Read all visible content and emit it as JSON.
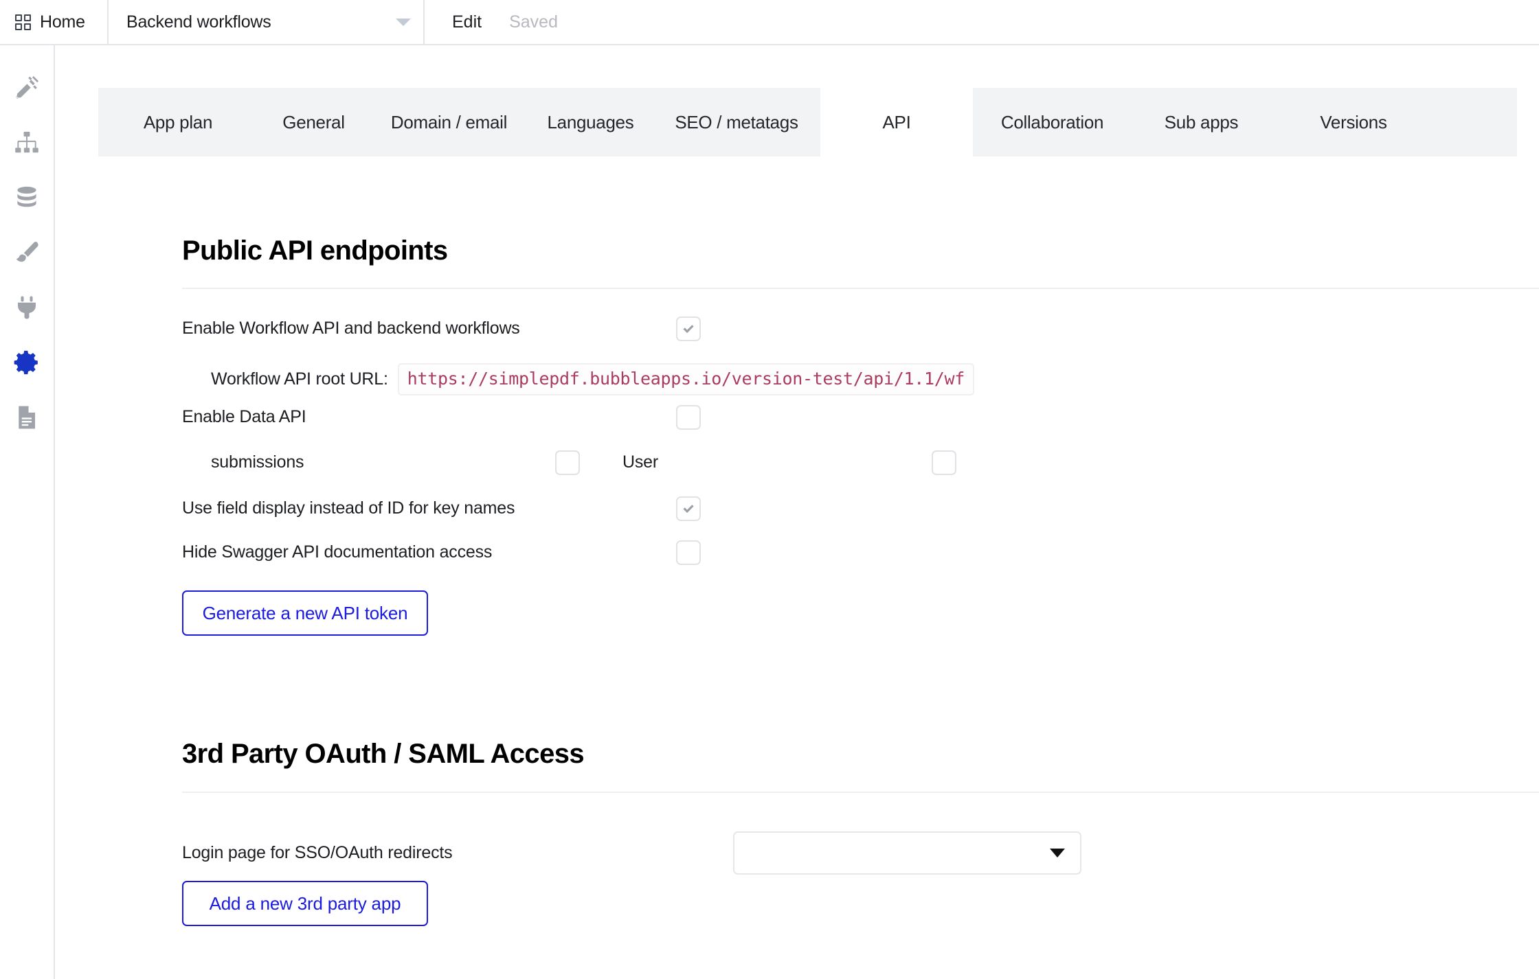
{
  "topbar": {
    "home_label": "Home",
    "home_icon": "grid-squares-icon",
    "app_selector_value": "Backend workflows",
    "app_selector_caret": "chevron-down-icon",
    "edit_label": "Edit",
    "status_label": "Saved"
  },
  "sidebar": {
    "items": [
      {
        "name": "design",
        "icon": "pencil-ruler-icon",
        "active": false
      },
      {
        "name": "workflow",
        "icon": "hierarchy-icon",
        "active": false
      },
      {
        "name": "data",
        "icon": "database-icon",
        "active": false
      },
      {
        "name": "styles",
        "icon": "paintbrush-icon",
        "active": false
      },
      {
        "name": "plugins",
        "icon": "plug-icon",
        "active": false
      },
      {
        "name": "settings",
        "icon": "gear-icon",
        "active": true
      },
      {
        "name": "logs",
        "icon": "document-icon",
        "active": false
      }
    ],
    "active_color": "#1834c4",
    "inactive_color": "#a0a4aa"
  },
  "tabs": [
    {
      "label": "App plan",
      "active": false
    },
    {
      "label": "General",
      "active": false
    },
    {
      "label": "Domain / email",
      "active": false
    },
    {
      "label": "Languages",
      "active": false
    },
    {
      "label": "SEO / metatags",
      "active": false
    },
    {
      "label": "API",
      "active": true
    },
    {
      "label": "Collaboration",
      "active": false
    },
    {
      "label": "Sub apps",
      "active": false
    },
    {
      "label": "Versions",
      "active": false
    }
  ],
  "api_section": {
    "title": "Public API endpoints",
    "enable_workflow_api": {
      "label": "Enable Workflow API and backend workflows",
      "checked": true
    },
    "workflow_root_url": {
      "label": "Workflow API root URL:",
      "value": "https://simplepdf.bubbleapps.io/version-test/api/1.1/wf",
      "color": "#ab3c5f"
    },
    "enable_data_api": {
      "label": "Enable Data API",
      "checked": false
    },
    "data_types": [
      {
        "label": "submissions",
        "checked": false
      },
      {
        "label": "User",
        "checked": false
      }
    ],
    "use_field_display": {
      "label": "Use field display instead of ID for key names",
      "checked": true
    },
    "hide_swagger": {
      "label": "Hide Swagger API documentation access",
      "checked": false
    },
    "generate_token_button": "Generate a new API token"
  },
  "oauth_section": {
    "title": "3rd Party OAuth / SAML Access",
    "login_page_label": "Login page for SSO/OAuth redirects",
    "login_page_value": "",
    "add_app_button": "Add a new 3rd party app"
  },
  "colors": {
    "accent_blue": "#1a1ae0",
    "active_icon": "#1834c4",
    "tab_strip_bg": "#f2f3f4",
    "url_text": "#ab3c5f"
  }
}
